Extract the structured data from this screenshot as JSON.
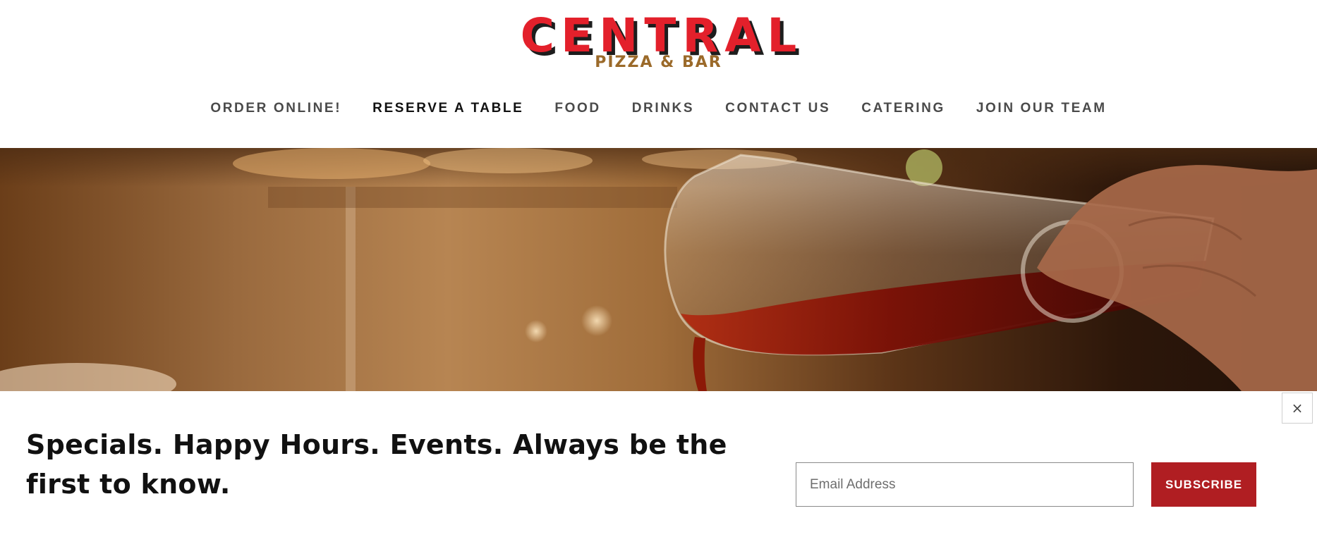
{
  "brand": {
    "name": "CENTRAL",
    "tagline": "PIZZA & BAR",
    "colors": {
      "red": "#e3202b",
      "gold": "#9b6a2a",
      "accent_button": "#b01e22"
    }
  },
  "nav": {
    "items": [
      {
        "label": "ORDER ONLINE!",
        "active": false
      },
      {
        "label": "RESERVE A TABLE",
        "active": true
      },
      {
        "label": "FOOD",
        "active": false
      },
      {
        "label": "DRINKS",
        "active": false
      },
      {
        "label": "CONTACT US",
        "active": false
      },
      {
        "label": "CATERING",
        "active": false
      },
      {
        "label": "JOIN OUR TEAM",
        "active": false
      }
    ]
  },
  "hero": {
    "icon": "wine-carafe-photo"
  },
  "newsletter": {
    "headline": "Specials. Happy Hours. Events. Always be the first to know.",
    "email_placeholder": "Email Address",
    "subscribe_label": "SUBSCRIBE",
    "close_label": "×"
  }
}
